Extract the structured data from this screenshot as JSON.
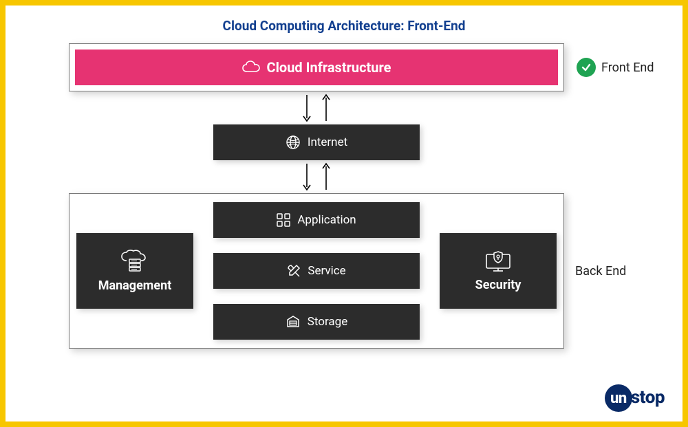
{
  "title": "Cloud Computing Architecture: Front-End",
  "front": {
    "box_label": "Cloud Infrastructure",
    "side_label": "Front End"
  },
  "middle": {
    "box_label": "Internet"
  },
  "back": {
    "side_label": "Back End",
    "management_label": "Management",
    "security_label": "Security",
    "application_label": "Application",
    "service_label": "Service",
    "storage_label": "Storage"
  },
  "brand": {
    "prefix": "un",
    "suffix": "stop"
  },
  "colors": {
    "accent_yellow": "#f7c600",
    "pink": "#e63372",
    "dark": "#2c2c2c",
    "navy": "#123f8f",
    "green": "#1fa352"
  }
}
